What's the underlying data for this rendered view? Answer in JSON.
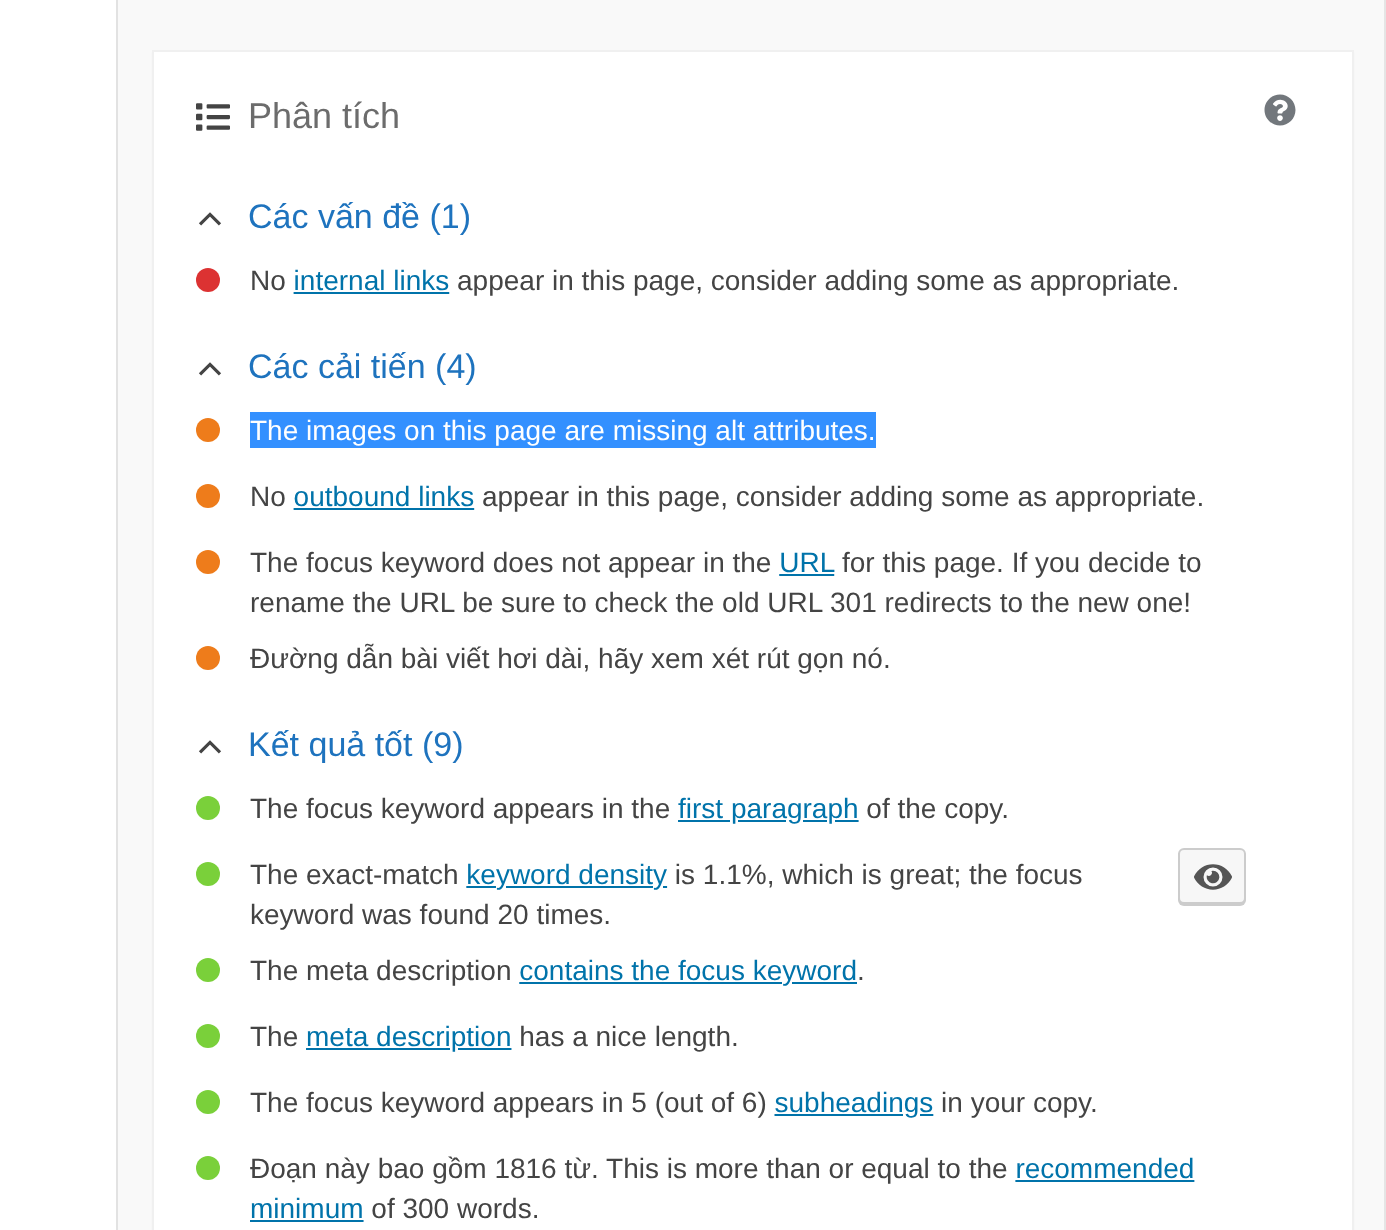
{
  "panel": {
    "title": "Phân tích",
    "sections": [
      {
        "heading": "Các vấn đề (1)",
        "expanded": true,
        "items": [
          {
            "color": "#dc3232",
            "highlighted": false,
            "eye_button": false,
            "parts": [
              {
                "kind": "text",
                "text": "No "
              },
              {
                "kind": "link",
                "text": "internal links"
              },
              {
                "kind": "text",
                "text": " appear in this page, consider adding some as appropriate."
              }
            ]
          }
        ]
      },
      {
        "heading": "Các cải tiến (4)",
        "expanded": true,
        "items": [
          {
            "color": "#ee7c1b",
            "highlighted": true,
            "eye_button": false,
            "parts": [
              {
                "kind": "text",
                "text": "The images on this page are missing alt attributes."
              }
            ]
          },
          {
            "color": "#ee7c1b",
            "highlighted": false,
            "eye_button": false,
            "parts": [
              {
                "kind": "text",
                "text": "No "
              },
              {
                "kind": "link",
                "text": "outbound links"
              },
              {
                "kind": "text",
                "text": " appear in this page, consider adding some as appropriate."
              }
            ]
          },
          {
            "color": "#ee7c1b",
            "highlighted": false,
            "eye_button": false,
            "parts": [
              {
                "kind": "text",
                "text": "The focus keyword does not appear in the "
              },
              {
                "kind": "link",
                "text": "URL"
              },
              {
                "kind": "text",
                "text": " for this page. If you decide to rename the URL be sure to check the old URL 301 redirects to the new one!"
              }
            ]
          },
          {
            "color": "#ee7c1b",
            "highlighted": false,
            "eye_button": false,
            "parts": [
              {
                "kind": "text",
                "text": "Đường dẫn bài viết hơi dài, hãy xem xét rút gọn nó."
              }
            ]
          }
        ]
      },
      {
        "heading": "Kết quả tốt (9)",
        "expanded": true,
        "items": [
          {
            "color": "#7ad03a",
            "highlighted": false,
            "eye_button": false,
            "parts": [
              {
                "kind": "text",
                "text": "The focus keyword appears in the "
              },
              {
                "kind": "link",
                "text": "first paragraph"
              },
              {
                "kind": "text",
                "text": " of the copy."
              }
            ]
          },
          {
            "color": "#7ad03a",
            "highlighted": false,
            "eye_button": true,
            "parts": [
              {
                "kind": "text",
                "text": "The exact-match "
              },
              {
                "kind": "link",
                "text": "keyword density"
              },
              {
                "kind": "text",
                "text": " is 1.1%, which is great; the focus keyword was found 20 times."
              }
            ]
          },
          {
            "color": "#7ad03a",
            "highlighted": false,
            "eye_button": false,
            "parts": [
              {
                "kind": "text",
                "text": "The meta description "
              },
              {
                "kind": "link",
                "text": "contains the focus keyword"
              },
              {
                "kind": "text",
                "text": "."
              }
            ]
          },
          {
            "color": "#7ad03a",
            "highlighted": false,
            "eye_button": false,
            "parts": [
              {
                "kind": "text",
                "text": "The "
              },
              {
                "kind": "link",
                "text": "meta description"
              },
              {
                "kind": "text",
                "text": " has a nice length."
              }
            ]
          },
          {
            "color": "#7ad03a",
            "highlighted": false,
            "eye_button": false,
            "parts": [
              {
                "kind": "text",
                "text": "The focus keyword appears in 5 (out of 6) "
              },
              {
                "kind": "link",
                "text": "subheadings"
              },
              {
                "kind": "text",
                "text": " in your copy."
              }
            ]
          },
          {
            "color": "#7ad03a",
            "highlighted": false,
            "eye_button": false,
            "parts": [
              {
                "kind": "text",
                "text": "Đoạn này bao gồm 1816 từ. This is more than or equal to the "
              },
              {
                "kind": "link",
                "text": "recommended"
              },
              {
                "kind": "link",
                "text": "minimum"
              },
              {
                "kind": "text",
                "text": " of 300 words."
              }
            ]
          }
        ]
      }
    ]
  }
}
